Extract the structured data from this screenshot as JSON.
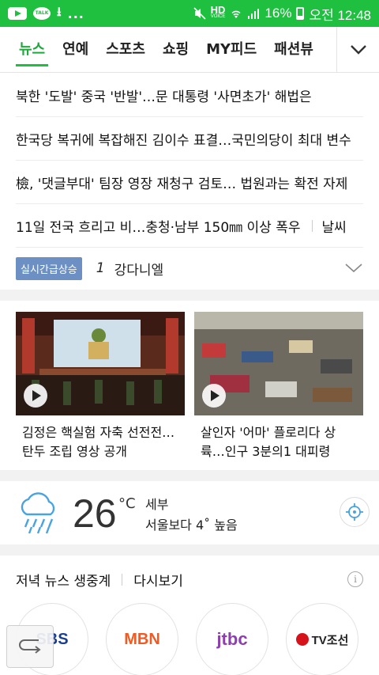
{
  "status_bar": {
    "icons": [
      "youtube-icon",
      "kakaotalk-icon",
      "download-icon"
    ],
    "more": "...",
    "hd_voice": "HD",
    "voice_text": "VOICE",
    "battery": "16%",
    "time": "오전 12:48",
    "color": "#1fbf3f"
  },
  "tabs": {
    "items": [
      "뉴스",
      "연예",
      "스포츠",
      "쇼핑",
      "MY피드",
      "패션뷰"
    ],
    "active": "뉴스",
    "more_icon": "chevron-down-icon"
  },
  "headlines": [
    "북한 '도발' 중국 '반발'…문 대통령 '사면초가' 해법은",
    "한국당 복귀에 복잡해진 김이수 표결…국민의당이 최대 변수",
    "檢, '댓글부대' 팀장 영장 재청구 검토… 법원과는 확전 자제",
    "11일 전국 흐리고 비…충청·남부 150㎜ 이상 폭우"
  ],
  "weather_link": "날씨",
  "realtime": {
    "badge": "실시간급상승",
    "rank": "1",
    "keyword": "강다니엘"
  },
  "videos": [
    {
      "title_line1": "김정은 핵실험 자축 선전전…",
      "title_line2": "탄두 조립 영상 공개"
    },
    {
      "title_line1": "살인자 '어마' 플로리다 상",
      "title_line2": "륙…인구 3분의1 대피령"
    }
  ],
  "weather": {
    "icon": "rain-cloud-icon",
    "temperature": "26",
    "unit": "°C",
    "location": "세부",
    "comparison": "서울보다 4˚ 높음"
  },
  "live_news": {
    "label": "저녁 뉴스 생중계",
    "replay": "다시보기",
    "info": "i",
    "channels": [
      "SBS",
      "MBN",
      "jtbc",
      "TV조선"
    ]
  },
  "colors": {
    "accent": "#1fbf3f",
    "badge": "#6c8fc4",
    "mbn": "#f15a22",
    "tvchosun": "#d6121b"
  }
}
